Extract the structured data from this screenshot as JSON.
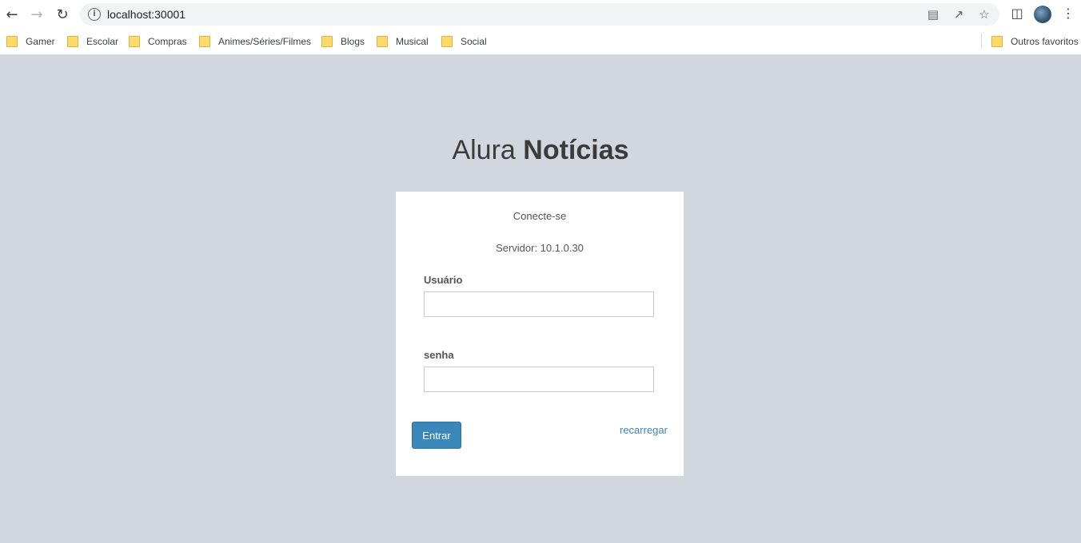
{
  "browser": {
    "url": "localhost:30001",
    "bookmarks": [
      {
        "label": "Gamer"
      },
      {
        "label": "Escolar"
      },
      {
        "label": "Compras"
      },
      {
        "label": "Animes/Séries/Filmes"
      },
      {
        "label": "Blogs"
      },
      {
        "label": "Musical"
      },
      {
        "label": "Social"
      }
    ],
    "other_bookmarks": "Outros favoritos"
  },
  "page": {
    "title_light": "Alura ",
    "title_bold": "Notícias",
    "card": {
      "heading": "Conecte-se",
      "server": "Servidor: 10.1.0.30",
      "user_label": "Usuário",
      "user_value": "",
      "password_label": "senha",
      "password_value": "",
      "submit_label": "Entrar",
      "reload_label": "recarregar"
    }
  },
  "colors": {
    "background": "#d1d6df",
    "primary_button": "#3a87b9",
    "link": "#3a87b9"
  }
}
